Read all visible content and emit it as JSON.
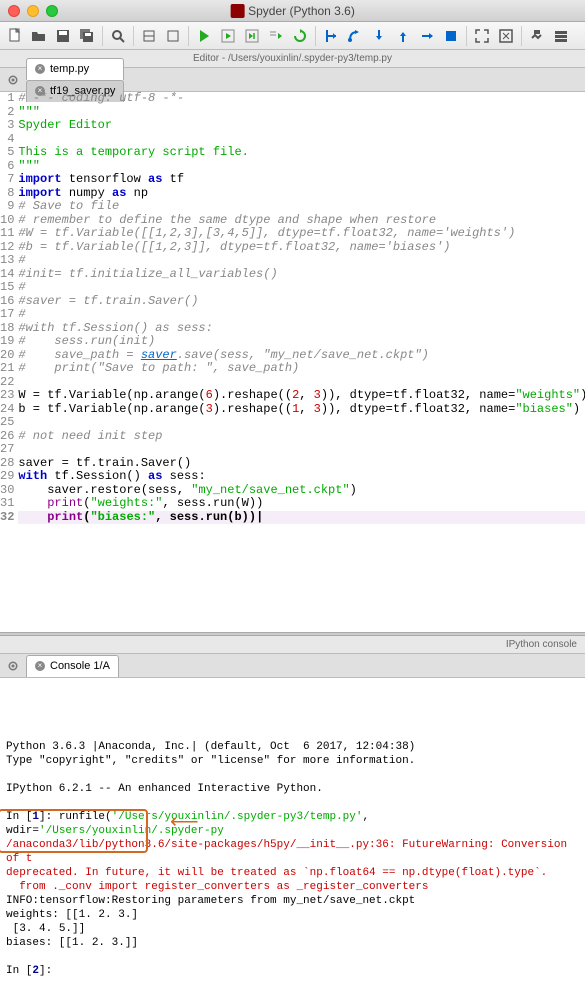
{
  "window": {
    "title": "Spyder (Python 3.6)"
  },
  "editor_header": "Editor - /Users/youxinlin/.spyder-py3/temp.py",
  "tabs": [
    {
      "label": "temp.py",
      "active": true
    },
    {
      "label": "tf19_saver.py",
      "active": false
    }
  ],
  "code_lines": [
    {
      "n": 1,
      "text": "# -*- coding: utf-8 -*-",
      "cls": "c-comment"
    },
    {
      "n": 2,
      "text": "\"\"\"",
      "cls": "c-string"
    },
    {
      "n": 3,
      "text": "Spyder Editor",
      "cls": "c-string"
    },
    {
      "n": 4,
      "text": "",
      "cls": ""
    },
    {
      "n": 5,
      "text": "This is a temporary script file.",
      "cls": "c-string"
    },
    {
      "n": 6,
      "text": "\"\"\"",
      "cls": "c-string"
    },
    {
      "n": 7,
      "html": "<span class='c-keyword'>import</span> tensorflow <span class='c-keyword'>as</span> tf"
    },
    {
      "n": 8,
      "html": "<span class='c-keyword'>import</span> numpy <span class='c-keyword'>as</span> np"
    },
    {
      "n": 9,
      "text": "# Save to file",
      "cls": "c-comment"
    },
    {
      "n": 10,
      "text": "# remember to define the same dtype and shape when restore",
      "cls": "c-comment"
    },
    {
      "n": 11,
      "text": "#W = tf.Variable([[1,2,3],[3,4,5]], dtype=tf.float32, name='weights')",
      "cls": "c-comment"
    },
    {
      "n": 12,
      "text": "#b = tf.Variable([[1,2,3]], dtype=tf.float32, name='biases')",
      "cls": "c-comment"
    },
    {
      "n": 13,
      "text": "#",
      "cls": "c-comment"
    },
    {
      "n": 14,
      "text": "#init= tf.initialize_all_variables()",
      "cls": "c-comment"
    },
    {
      "n": 15,
      "text": "#",
      "cls": "c-comment"
    },
    {
      "n": 16,
      "text": "#saver = tf.train.Saver()",
      "cls": "c-comment"
    },
    {
      "n": 17,
      "text": "#",
      "cls": "c-comment"
    },
    {
      "n": 18,
      "text": "#with tf.Session() as sess:",
      "cls": "c-comment"
    },
    {
      "n": 19,
      "text": "#    sess.run(init)",
      "cls": "c-comment"
    },
    {
      "n": 20,
      "html": "<span class='c-comment'>#    save_path = </span><span class='c-link'>saver</span><span class='c-comment'>.save(sess, \"my_net/save_net.ckpt\")</span>"
    },
    {
      "n": 21,
      "text": "#    print(\"Save to path: \", save_path)",
      "cls": "c-comment"
    },
    {
      "n": 22,
      "text": "",
      "cls": ""
    },
    {
      "n": 23,
      "html": "W = tf.Variable(np.arange(<span class='c-number'>6</span>).reshape((<span class='c-number'>2</span>, <span class='c-number'>3</span>)), dtype=tf.float32, name=<span class='c-string'>\"weights\"</span>)"
    },
    {
      "n": 24,
      "html": "b = tf.Variable(np.arange(<span class='c-number'>3</span>).reshape((<span class='c-number'>1</span>, <span class='c-number'>3</span>)), dtype=tf.float32, name=<span class='c-string'>\"biases\"</span>)"
    },
    {
      "n": 25,
      "text": "",
      "cls": ""
    },
    {
      "n": 26,
      "text": "# not need init step",
      "cls": "c-comment"
    },
    {
      "n": 27,
      "text": "",
      "cls": ""
    },
    {
      "n": 28,
      "text": "saver = tf.train.Saver()"
    },
    {
      "n": 29,
      "html": "<span class='c-keyword'>with</span> tf.Session() <span class='c-keyword'>as</span> sess:"
    },
    {
      "n": 30,
      "html": "    saver.restore(sess, <span class='c-string'>\"my_net/save_net.ckpt\"</span>)"
    },
    {
      "n": 31,
      "html": "    <span class='c-builtin'>print</span>(<span class='c-string'>\"weights:\"</span>, sess.run(W))"
    },
    {
      "n": 32,
      "html": "    <span class='c-builtin'>print</span>(<span class='c-string'>\"biases:\"</span>, sess.run(b))<b>|</b>",
      "current": true
    }
  ],
  "console": {
    "header": "IPython console",
    "tab_label": "Console 1/A",
    "lines": [
      {
        "text": "Python 3.6.3 |Anaconda, Inc.| (default, Oct  6 2017, 12:04:38)"
      },
      {
        "text": "Type \"copyright\", \"credits\" or \"license\" for more information."
      },
      {
        "text": ""
      },
      {
        "text": "IPython 6.2.1 -- An enhanced Interactive Python."
      },
      {
        "text": ""
      },
      {
        "html": "In [<span class='con-blue'>1</span>]: runfile(<span class='con-green'>'/Users/youxinlin/.spyder-py3/temp.py'</span>, wdir=<span class='con-green'>'/Users/youxinlin/.spyder-py</span>"
      },
      {
        "html": "<span class='con-red'>/anaconda3/lib/python3.6/site-packages/h5py/__init__.py:36: FutureWarning: Conversion of t</span>"
      },
      {
        "html": "<span class='con-red'>deprecated. In future, it will be treated as `np.float64 == np.dtype(float).type`.</span>"
      },
      {
        "html": "<span class='con-red'>  from ._conv import register_converters as _register_converters</span>"
      },
      {
        "text": "INFO:tensorflow:Restoring parameters from my_net/save_net.ckpt"
      },
      {
        "text": "weights: [[1. 2. 3.]"
      },
      {
        "text": " [3. 4. 5.]]"
      },
      {
        "text": "biases: [[1. 2. 3.]]"
      },
      {
        "text": ""
      },
      {
        "html": "In [<span class='con-blue'>2</span>]: "
      }
    ]
  }
}
